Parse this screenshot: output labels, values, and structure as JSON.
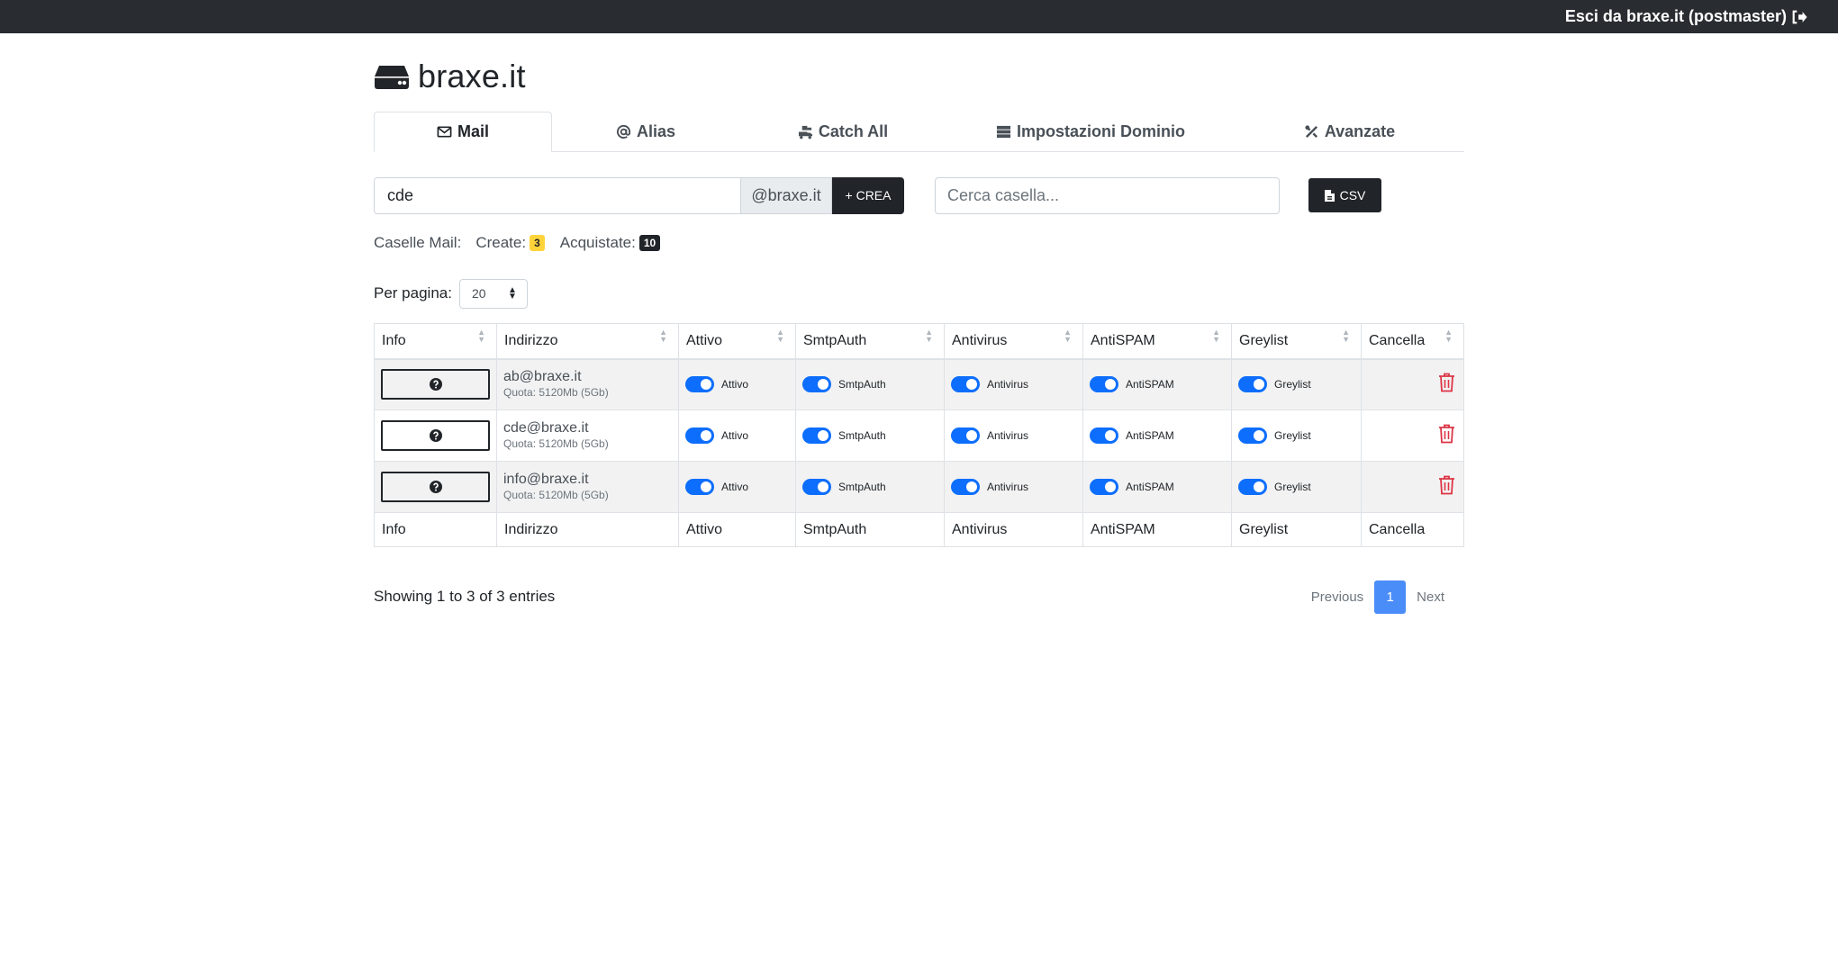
{
  "topbar": {
    "logout_label": "Esci da braxe.it (postmaster)"
  },
  "brand": {
    "title": "braxe.it"
  },
  "tabs": [
    {
      "label": "Mail",
      "icon": "envelope-icon",
      "active": true
    },
    {
      "label": "Alias",
      "icon": "at-icon",
      "active": false
    },
    {
      "label": "Catch All",
      "icon": "truck-loading-icon",
      "active": false
    },
    {
      "label": "Impostazioni Dominio",
      "icon": "server-icon",
      "active": false
    },
    {
      "label": "Avanzate",
      "icon": "tools-icon",
      "active": false
    }
  ],
  "create": {
    "value": "cde",
    "domain_suffix": "@braxe.it",
    "button_label": "+ CREA"
  },
  "search": {
    "placeholder": "Cerca casella..."
  },
  "csv": {
    "label": "CSV"
  },
  "stats": {
    "label": "Caselle Mail:",
    "created_label": "Create:",
    "created_count": "3",
    "purchased_label": "Acquistate:",
    "purchased_count": "10"
  },
  "perpage": {
    "label": "Per pagina:",
    "value": "20"
  },
  "table": {
    "headers": [
      "Info",
      "Indirizzo",
      "Attivo",
      "SmtpAuth",
      "Antivirus",
      "AntiSPAM",
      "Greylist",
      "Cancella"
    ],
    "toggle_labels": [
      "Attivo",
      "SmtpAuth",
      "Antivirus",
      "AntiSPAM",
      "Greylist"
    ],
    "rows": [
      {
        "address": "ab@braxe.it",
        "quota": "Quota: 5120Mb (5Gb)",
        "attivo": true,
        "smtpauth": true,
        "antivirus": true,
        "antispam": true,
        "greylist": true
      },
      {
        "address": "cde@braxe.it",
        "quota": "Quota: 5120Mb (5Gb)",
        "attivo": true,
        "smtpauth": true,
        "antivirus": true,
        "antispam": true,
        "greylist": true
      },
      {
        "address": "info@braxe.it",
        "quota": "Quota: 5120Mb (5Gb)",
        "attivo": true,
        "smtpauth": true,
        "antivirus": true,
        "antispam": true,
        "greylist": true
      }
    ]
  },
  "pagination": {
    "showing": "Showing 1 to 3 of 3 entries",
    "previous": "Previous",
    "current": "1",
    "next": "Next"
  },
  "colors": {
    "topbar": "#292c31",
    "toggle_on": "#0d6efd",
    "page_active": "#4a8df8",
    "delete": "#dc3545",
    "badge_created": "#ffd43b",
    "badge_purchased": "#212529"
  }
}
